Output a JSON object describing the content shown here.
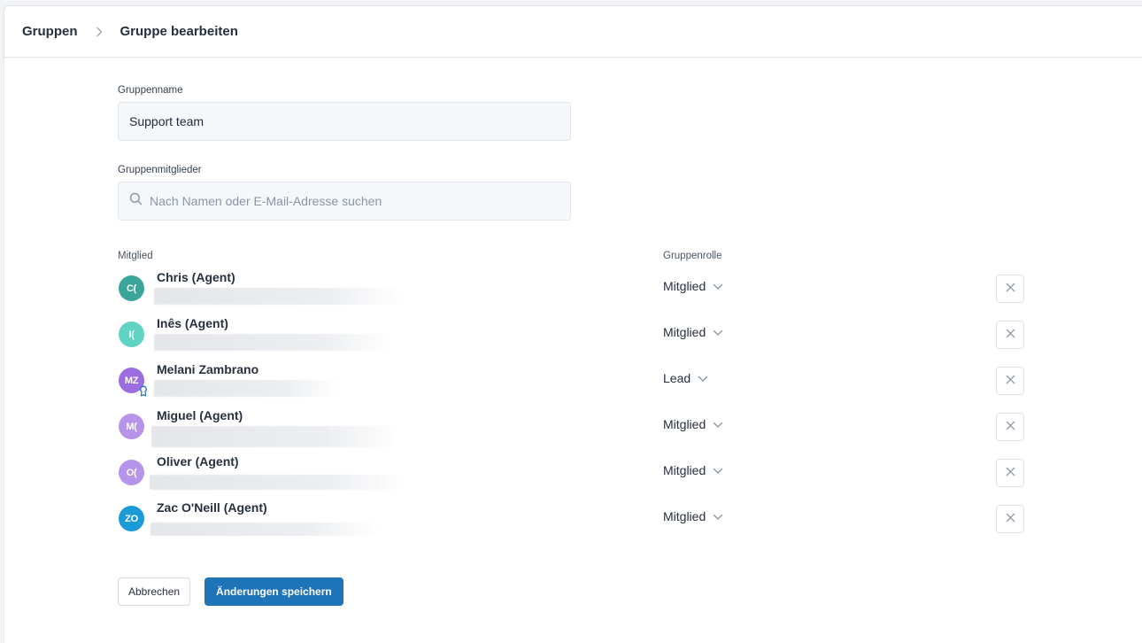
{
  "breadcrumb": {
    "parent": "Gruppen",
    "current": "Gruppe bearbeiten"
  },
  "form": {
    "name_label": "Gruppenname",
    "name_value": "Support team",
    "members_label": "Gruppenmitglieder",
    "search_placeholder": "Nach Namen oder E-Mail-Adresse suchen"
  },
  "table": {
    "col_member": "Mitglied",
    "col_role": "Gruppenrolle"
  },
  "members": [
    {
      "initials": "C(",
      "name": "Chris (Agent)",
      "role": "Mitglied",
      "avatar_color": "#3aa59a"
    },
    {
      "initials": "I(",
      "name": "Inês (Agent)",
      "role": "Mitglied",
      "avatar_color": "#5fd3c4"
    },
    {
      "initials": "MZ",
      "name": "Melani Zambrano",
      "role": "Lead",
      "avatar_color": "#9b6de0"
    },
    {
      "initials": "M(",
      "name": "Miguel (Agent)",
      "role": "Mitglied",
      "avatar_color": "#b694ea"
    },
    {
      "initials": "O(",
      "name": "Oliver (Agent)",
      "role": "Mitglied",
      "avatar_color": "#b694ea"
    },
    {
      "initials": "ZO",
      "name": "Zac O'Neill (Agent)",
      "role": "Mitglied",
      "avatar_color": "#1a9ad6"
    }
  ],
  "actions": {
    "cancel_label": "Abbrechen",
    "save_label": "Änderungen speichern"
  },
  "colors": {
    "primary": "#1f73b7",
    "lead_badge": "#1f73b7"
  },
  "icons": {
    "breadcrumb_separator": "chevron-right-icon",
    "search": "search-icon",
    "role_dropdown": "chevron-down-icon",
    "remove": "close-icon",
    "lead_badge": "award-icon"
  }
}
